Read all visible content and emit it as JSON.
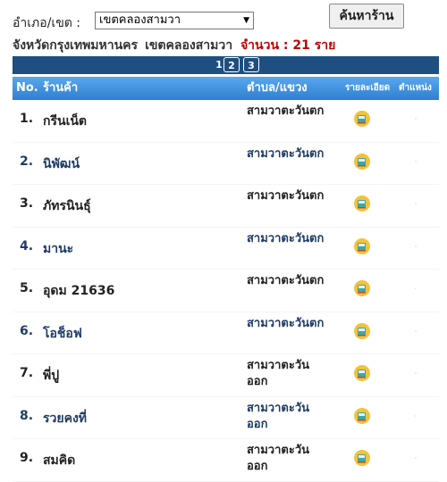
{
  "search": {
    "district_label": "อำเภอ/เขต :",
    "district_selected": "เขตคลองสามวา",
    "search_button": "ค้นหาร้าน"
  },
  "summary": {
    "province": "จังหวัดกรุงเทพมหานคร",
    "district": "เขตคลองสามวา",
    "count_label": "จำนวน :",
    "count_value": "21 ราย"
  },
  "pager": {
    "pages": [
      "1",
      "2",
      "3"
    ],
    "current": "1"
  },
  "table": {
    "headers": {
      "no": "No.",
      "shop": "ร้านค้า",
      "subdistrict": "ตำบล/แขวง",
      "details": "รายละเอียด",
      "location": "ตำแหน่ง"
    },
    "rows": [
      {
        "no": "1.",
        "name": "กรีนเน็ต",
        "subdistrict": "สามวาตะวันตก"
      },
      {
        "no": "2.",
        "name": "นิพัฒน์",
        "subdistrict": "สามวาตะวันตก"
      },
      {
        "no": "3.",
        "name": "ภัทรนินธุ์",
        "subdistrict": "สามวาตะวันตก"
      },
      {
        "no": "4.",
        "name": "มานะ",
        "subdistrict": "สามวาตะวันตก"
      },
      {
        "no": "5.",
        "name": "อุดม 21636",
        "subdistrict": "สามวาตะวันตก"
      },
      {
        "no": "6.",
        "name": "โอช็อฟ",
        "subdistrict": "สามวาตะวันตก"
      },
      {
        "no": "7.",
        "name": "พี่ปู",
        "subdistrict": "สามวาตะวันออก"
      },
      {
        "no": "8.",
        "name": "รวยคงที่",
        "subdistrict": "สามวาตะวันออก"
      },
      {
        "no": "9.",
        "name": "สมคิด",
        "subdistrict": "สามวาตะวันออก"
      }
    ]
  },
  "colors": {
    "header_blue": "#3a8ee0",
    "pager_navy": "#1e4f80",
    "count_red": "#c00000",
    "link_navy": "#1f3b66"
  },
  "icons": {
    "details": "book-icon",
    "location": "map-marker-icon"
  }
}
